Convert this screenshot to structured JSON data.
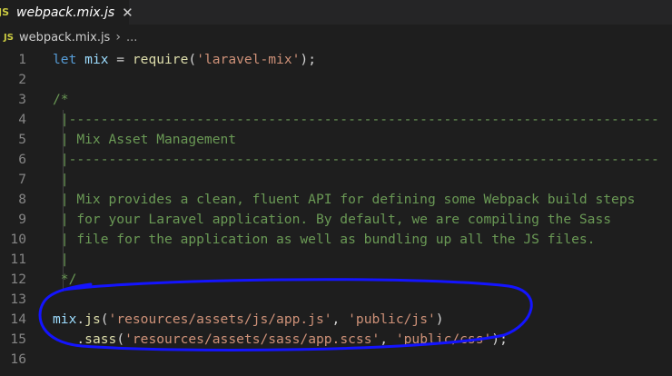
{
  "tab": {
    "icon": "JS",
    "name": "webpack.mix.js",
    "close": "✕"
  },
  "breadcrumb": {
    "icon": "JS",
    "file": "webpack.mix.js",
    "separator": "›",
    "rest": "..."
  },
  "lines": [
    {
      "n": "1",
      "tokens": [
        [
          "kw",
          "let"
        ],
        [
          "plain",
          " "
        ],
        [
          "var",
          "mix"
        ],
        [
          "op",
          " = "
        ],
        [
          "fn",
          "require"
        ],
        [
          "op",
          "("
        ],
        [
          "str",
          "'laravel-mix'"
        ],
        [
          "op",
          ");"
        ]
      ]
    },
    {
      "n": "2",
      "tokens": []
    },
    {
      "n": "3",
      "tokens": [
        [
          "cm",
          "/*"
        ]
      ]
    },
    {
      "n": "4",
      "tokens": [
        [
          "cm",
          " |--------------------------------------------------------------------------"
        ]
      ]
    },
    {
      "n": "5",
      "tokens": [
        [
          "cm",
          " | Mix Asset Management"
        ]
      ]
    },
    {
      "n": "6",
      "tokens": [
        [
          "cm",
          " |--------------------------------------------------------------------------"
        ]
      ]
    },
    {
      "n": "7",
      "tokens": [
        [
          "cm",
          " |"
        ]
      ]
    },
    {
      "n": "8",
      "tokens": [
        [
          "cm",
          " | Mix provides a clean, fluent API for defining some Webpack build steps"
        ]
      ]
    },
    {
      "n": "9",
      "tokens": [
        [
          "cm",
          " | for your Laravel application. By default, we are compiling the Sass"
        ]
      ]
    },
    {
      "n": "10",
      "tokens": [
        [
          "cm",
          " | file for the application as well as bundling up all the JS files."
        ]
      ]
    },
    {
      "n": "11",
      "tokens": [
        [
          "cm",
          " |"
        ]
      ]
    },
    {
      "n": "12",
      "tokens": [
        [
          "cm",
          " */"
        ]
      ]
    },
    {
      "n": "13",
      "tokens": []
    },
    {
      "n": "14",
      "tokens": [
        [
          "var",
          "mix"
        ],
        [
          "op",
          "."
        ],
        [
          "fn",
          "js"
        ],
        [
          "op",
          "("
        ],
        [
          "str",
          "'resources/assets/js/app.js'"
        ],
        [
          "op",
          ", "
        ],
        [
          "str",
          "'public/js'"
        ],
        [
          "op",
          ")"
        ]
      ]
    },
    {
      "n": "15",
      "tokens": [
        [
          "plain",
          "   ."
        ],
        [
          "fn",
          "sass"
        ],
        [
          "op",
          "("
        ],
        [
          "str",
          "'resources/assets/sass/app.scss'"
        ],
        [
          "op",
          ", "
        ],
        [
          "str",
          "'public/css'"
        ],
        [
          "op",
          ");"
        ]
      ]
    },
    {
      "n": "16",
      "tokens": []
    }
  ],
  "colors": {
    "background": "#1e1e1e",
    "annotation": "#1414ff"
  }
}
